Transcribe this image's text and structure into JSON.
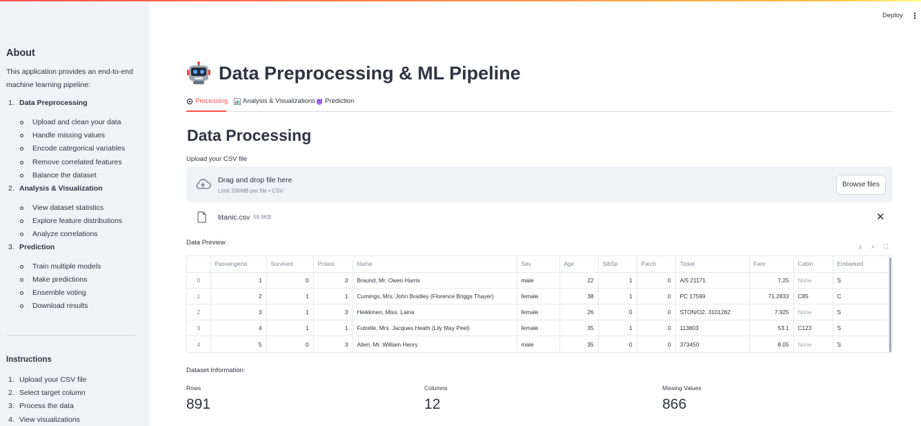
{
  "header": {
    "deploy_label": "Deploy",
    "menu_icon": "kebab-menu-icon"
  },
  "sidebar": {
    "about_heading": "About",
    "about_text": "This application provides an end-to-end machine learning pipeline:",
    "sections": [
      {
        "number": "1.",
        "title": "Data Preprocessing",
        "items": [
          "Upload and clean your data",
          "Handle missing values",
          "Encode categorical variables",
          "Remove correlated features",
          "Balance the dataset"
        ]
      },
      {
        "number": "2.",
        "title": "Analysis & Visualization",
        "items": [
          "View dataset statistics",
          "Explore feature distributions",
          "Analyze correlations"
        ]
      },
      {
        "number": "3.",
        "title": "Prediction",
        "items": [
          "Train multiple models",
          "Make predictions",
          "Ensemble voting",
          "Download results"
        ]
      }
    ],
    "instructions_heading": "Instructions",
    "instructions": [
      {
        "number": "1.",
        "text": "Upload your CSV file"
      },
      {
        "number": "2.",
        "text": "Select target column"
      },
      {
        "number": "3.",
        "text": "Process the data"
      },
      {
        "number": "4.",
        "text": "View visualizations"
      }
    ]
  },
  "main": {
    "title": "Data Preprocessing & ML Pipeline",
    "title_icon": "robot-icon",
    "tabs": [
      {
        "label": "Processing",
        "icon": "gear-icon",
        "active": true
      },
      {
        "label": "Analysis & Visualizations",
        "icon": "bar-chart-icon",
        "active": false
      },
      {
        "label": "Prediction",
        "icon": "devil-icon",
        "active": false
      }
    ],
    "section_title": "Data Processing",
    "upload": {
      "label": "Upload your CSV file",
      "drop_title": "Drag and drop file here",
      "drop_subtitle": "Limit 200MB per file • CSV",
      "browse_label": "Browse files",
      "file_name": "titanic.csv",
      "file_size": "58.9KB"
    },
    "preview_label": "Data Preview:",
    "table": {
      "columns": [
        "",
        "PassengerId",
        "Survived",
        "Pclass",
        "Name",
        "Sex",
        "Age",
        "SibSp",
        "Parch",
        "Ticket",
        "Fare",
        "Cabin",
        "Embarked"
      ],
      "rows": [
        [
          "0",
          "1",
          "0",
          "3",
          "Braund, Mr. Owen Harris",
          "male",
          "22",
          "1",
          "0",
          "A/5 21171",
          "7.25",
          "None",
          "S"
        ],
        [
          "1",
          "2",
          "1",
          "1",
          "Cumings, Mrs. John Bradley (Florence Briggs Thayer)",
          "female",
          "38",
          "1",
          "0",
          "PC 17599",
          "71.2833",
          "C85",
          "C"
        ],
        [
          "2",
          "3",
          "1",
          "3",
          "Heikkinen, Miss. Laina",
          "female",
          "26",
          "0",
          "0",
          "STON/O2. 3101282",
          "7.925",
          "None",
          "S"
        ],
        [
          "3",
          "4",
          "1",
          "1",
          "Futrelle, Mrs. Jacques Heath (Lily May Peel)",
          "female",
          "35",
          "1",
          "0",
          "113803",
          "53.1",
          "C123",
          "S"
        ],
        [
          "4",
          "5",
          "0",
          "3",
          "Allen, Mr. William Henry",
          "male",
          "35",
          "0",
          "0",
          "373450",
          "8.05",
          "None",
          "S"
        ]
      ]
    },
    "dataset_info_label": "Dataset Information:",
    "metrics": [
      {
        "label": "Rows",
        "value": "891"
      },
      {
        "label": "Columns",
        "value": "12"
      },
      {
        "label": "Missing Values",
        "value": "866"
      }
    ]
  },
  "colors": {
    "accent": "#ff4b4b",
    "sidebar_bg": "#f0f2f6",
    "text": "#31333f",
    "muted": "#808495"
  }
}
